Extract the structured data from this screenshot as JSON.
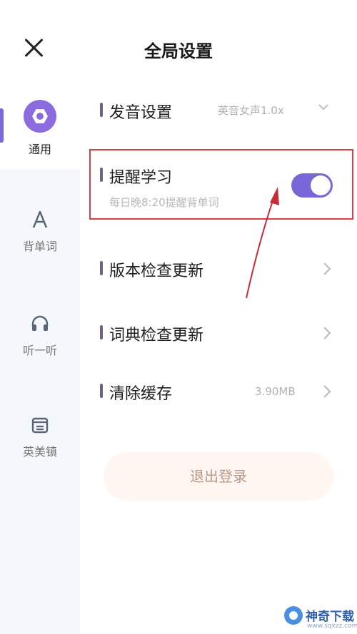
{
  "header": {
    "title": "全局设置"
  },
  "sidebar": {
    "items": [
      {
        "label": "通用",
        "icon": "gear-icon",
        "active": true
      },
      {
        "label": "背单词",
        "icon": "letter-a-icon",
        "active": false
      },
      {
        "label": "听一听",
        "icon": "headphones-icon",
        "active": false
      },
      {
        "label": "英美镇",
        "icon": "town-icon",
        "active": false
      }
    ]
  },
  "settings": {
    "pronunciation": {
      "title": "发音设置",
      "value": "英音女声1.0x"
    },
    "reminder": {
      "title": "提醒学习",
      "subtitle": "每日晚8:20提醒背单词",
      "enabled": true
    },
    "version_check": {
      "title": "版本检查更新"
    },
    "dictionary_check": {
      "title": "词典检查更新"
    },
    "clear_cache": {
      "title": "清除缓存",
      "value": "3.90MB"
    }
  },
  "logout": {
    "label": "退出登录"
  },
  "watermark": {
    "name": "神奇下载",
    "url": "www.sqxzz.com"
  },
  "colors": {
    "accent": "#7b66d9",
    "highlight_border": "#d6404b",
    "sidebar_bg": "#f4f7fb"
  }
}
